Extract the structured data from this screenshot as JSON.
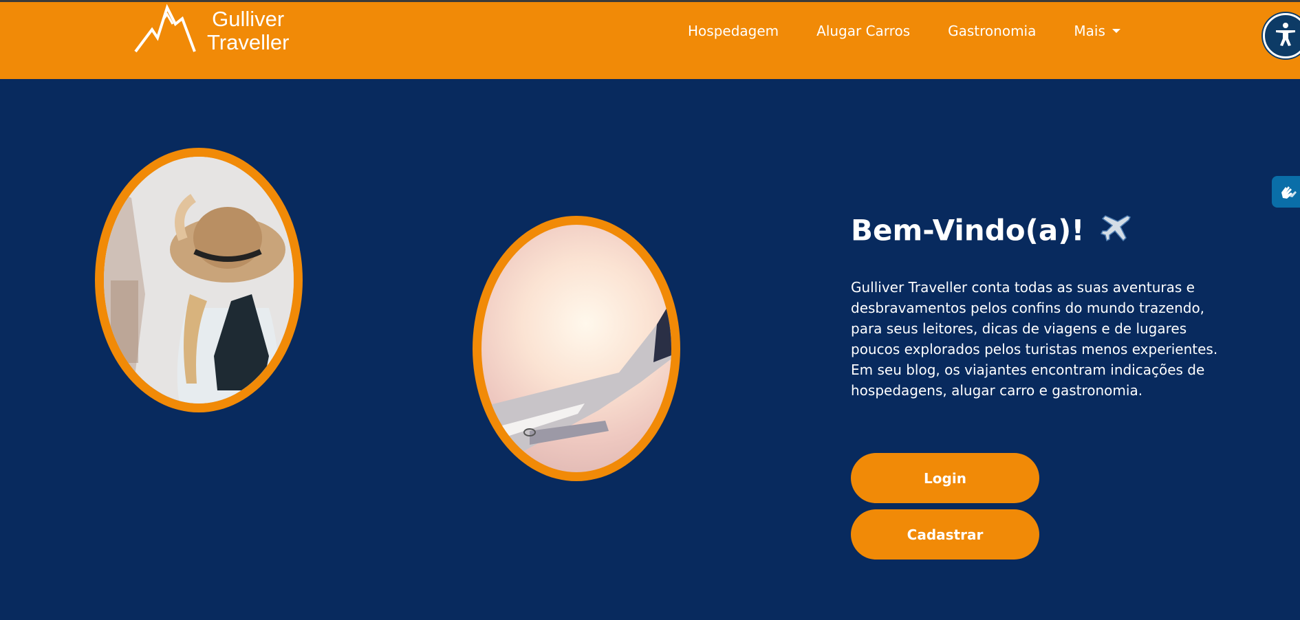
{
  "brand": {
    "line1": "Gulliver",
    "line2": "Traveller",
    "logo_icon": "mountain-logo-icon"
  },
  "nav": {
    "items": [
      {
        "label": "Hospedagem"
      },
      {
        "label": "Alugar Carros"
      },
      {
        "label": "Gastronomia"
      },
      {
        "label": "Mais"
      }
    ]
  },
  "accessibility": {
    "icon": "accessibility-icon",
    "sign_language_icon": "hand-sign-icon"
  },
  "hero": {
    "heading": "Bem-Vindo(a)!",
    "heading_icon": "airplane-icon",
    "description": "Gulliver Traveller conta todas as suas aventuras e desbravamentos pelos confins do mundo trazendo, para seus leitores, dicas de viagens e de lugares poucos explorados pelos turistas menos experientes. Em seu blog, os viajantes encontram indicações de hospedagens, alugar carro e gastronomia.",
    "login_label": "Login",
    "register_label": "Cadastrar"
  },
  "colors": {
    "accent": "#f18a07",
    "background": "#082a5e"
  }
}
